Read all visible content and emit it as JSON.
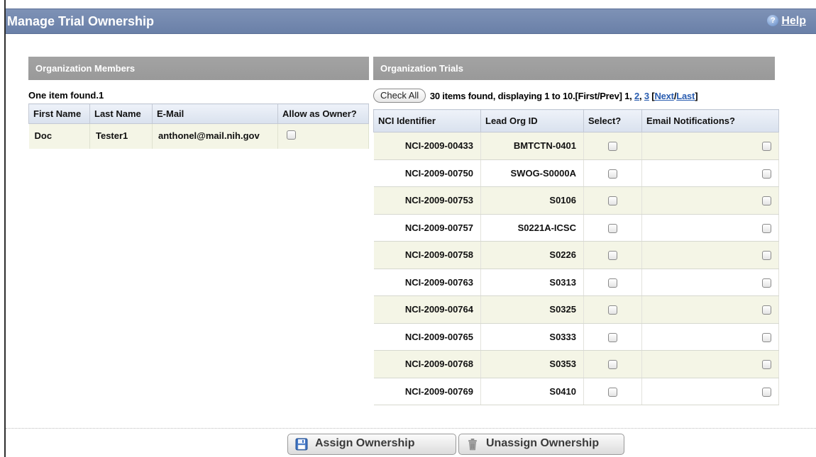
{
  "page": {
    "title": "Manage Trial Ownership",
    "help_label": "Help"
  },
  "members": {
    "header": "Organization Members",
    "found_text": "One item found.1",
    "columns": [
      "First Name",
      "Last Name",
      "E-Mail",
      "Allow as Owner?"
    ],
    "rows": [
      {
        "first_name": "Doc",
        "last_name": "Tester1",
        "email": "anthonel@mail.nih.gov",
        "allow_owner": false
      }
    ]
  },
  "trials": {
    "header": "Organization Trials",
    "check_all_label": "Check All",
    "pager": {
      "summary": "30 items found, displaying 1 to 10.",
      "first_prev": "[First/Prev] 1, ",
      "page2": "2",
      "sep": ", ",
      "page3": "3",
      "bracket_open": " [",
      "next": "Next",
      "slash": "/",
      "last": "Last",
      "bracket_close": "]"
    },
    "columns": [
      "NCI Identifier",
      "Lead Org ID",
      "Select?",
      "Email Notifications?"
    ],
    "rows": [
      {
        "nci_id": "NCI-2009-00433",
        "lead_org_id": "BMTCTN-0401",
        "select": false,
        "email": false
      },
      {
        "nci_id": "NCI-2009-00750",
        "lead_org_id": "SWOG-S0000A",
        "select": false,
        "email": false
      },
      {
        "nci_id": "NCI-2009-00753",
        "lead_org_id": "S0106",
        "select": false,
        "email": false
      },
      {
        "nci_id": "NCI-2009-00757",
        "lead_org_id": "S0221A-ICSC",
        "select": false,
        "email": false
      },
      {
        "nci_id": "NCI-2009-00758",
        "lead_org_id": "S0226",
        "select": false,
        "email": false
      },
      {
        "nci_id": "NCI-2009-00763",
        "lead_org_id": "S0313",
        "select": false,
        "email": false
      },
      {
        "nci_id": "NCI-2009-00764",
        "lead_org_id": "S0325",
        "select": false,
        "email": false
      },
      {
        "nci_id": "NCI-2009-00765",
        "lead_org_id": "S0333",
        "select": false,
        "email": false
      },
      {
        "nci_id": "NCI-2009-00768",
        "lead_org_id": "S0353",
        "select": false,
        "email": false
      },
      {
        "nci_id": "NCI-2009-00769",
        "lead_org_id": "S0410",
        "select": false,
        "email": false
      }
    ]
  },
  "actions": {
    "assign_label": "Assign Ownership",
    "unassign_label": "Unassign Ownership"
  },
  "icons": {
    "help": "help-icon",
    "assign": "save-disk-icon",
    "unassign": "trash-icon"
  },
  "colors": {
    "titlebar": "#6a80a8",
    "panel_header": "#9e9e9e",
    "row_alt": "#f4f5e6",
    "link": "#2a5db0"
  }
}
